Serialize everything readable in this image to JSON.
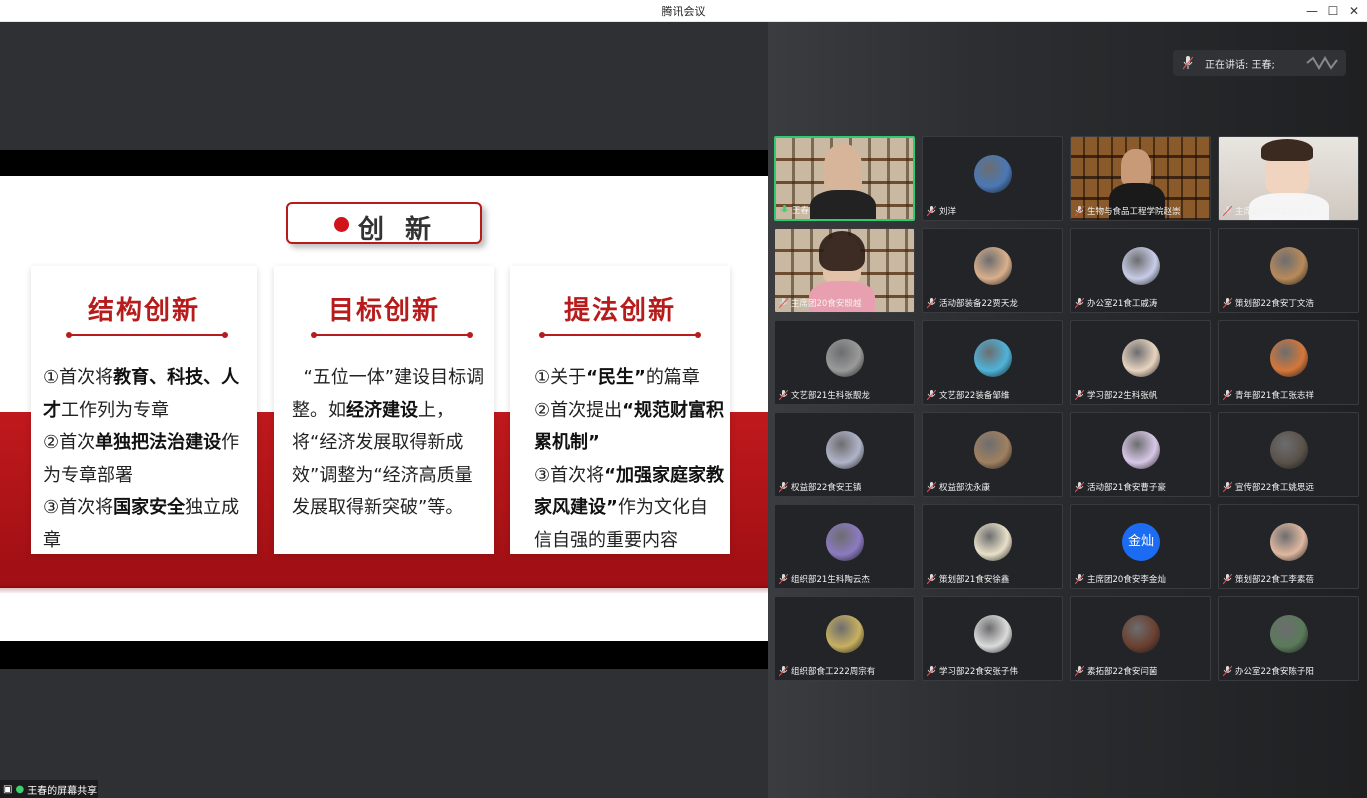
{
  "window": {
    "title": "腾讯会议"
  },
  "slide": {
    "title": "创 新",
    "cards": [
      {
        "heading": "结构创新",
        "html": "①首次将<b>教育、科技、人才</b>工作列为专章<br>②首次<b>单独把法治建设</b>作为专章部署<br>③首次将<b>国家安全</b>独立成章"
      },
      {
        "heading": "目标创新",
        "html": "&nbsp;&nbsp;“五位一体”建设目标调整。如<b>经济建设</b>上，将“经济发展取得新成效”调整为“经济高质量发展取得新突破”等。"
      },
      {
        "heading": "提法创新",
        "html": "①关于<b>“民生”</b>的篇章<br>②首次提出<b>“规范财富积累机制”</b><br>③首次将<b>“加强家庭家教家风建设”</b>作为文化自信自强的重要内容"
      }
    ]
  },
  "speaker": {
    "label": "正在讲话: 王春;"
  },
  "participants": [
    {
      "name": "王春",
      "kind": "video-shelf"
    },
    {
      "name": "刘洋",
      "kind": "avatar",
      "color": "#4a78b5"
    },
    {
      "name": "生物与食品工程学院赵崇",
      "kind": "video-dark"
    },
    {
      "name": "主席团20食工孙兴达",
      "kind": "video-light"
    },
    {
      "name": "主席团20食安殷越",
      "kind": "video-shelf2"
    },
    {
      "name": "活动部装备22贾天龙",
      "kind": "avatar",
      "color": "#d9b08c"
    },
    {
      "name": "办公室21食工戚涛",
      "kind": "avatar",
      "color": "#c8cde8"
    },
    {
      "name": "策划部22食安丁文浩",
      "kind": "avatar",
      "color": "#b98a5a"
    },
    {
      "name": "文艺部21生科张靓龙",
      "kind": "avatar",
      "color": "#9a9a9a"
    },
    {
      "name": "文艺部22装备邹维",
      "kind": "avatar",
      "color": "#4fb3d9"
    },
    {
      "name": "学习部22生科张帆",
      "kind": "avatar",
      "color": "#e8d4c0"
    },
    {
      "name": "青年部21食工张志祥",
      "kind": "avatar",
      "color": "#d4773a"
    },
    {
      "name": "权益部22食安王镇",
      "kind": "avatar",
      "color": "#b0b4c8"
    },
    {
      "name": "权益部沈永康",
      "kind": "avatar",
      "color": "#a08060"
    },
    {
      "name": "活动部21食安曹子豪",
      "kind": "avatar",
      "color": "#d8c8e8"
    },
    {
      "name": "宣传部22食工姚思远",
      "kind": "avatar",
      "color": "#5a524a"
    },
    {
      "name": "组织部21生科陶云杰",
      "kind": "avatar",
      "color": "#8c7ac0"
    },
    {
      "name": "策划部21食安徐鑫",
      "kind": "avatar",
      "color": "#e8e0c8"
    },
    {
      "name": "主席团20食安李金灿",
      "kind": "text-avatar",
      "text": "金灿"
    },
    {
      "name": "策划部22食工李素蓓",
      "kind": "avatar",
      "color": "#e0b8a0"
    },
    {
      "name": "组织部食工222周宗有",
      "kind": "avatar",
      "color": "#c8b060"
    },
    {
      "name": "学习部22食安张子伟",
      "kind": "avatar",
      "color": "#dcdcdc"
    },
    {
      "name": "素拓部22食安闫菌",
      "kind": "avatar",
      "color": "#6a4030"
    },
    {
      "name": "办公室22食安陈子阳",
      "kind": "avatar",
      "color": "#5a7a5a"
    }
  ],
  "sharebar": {
    "label": "王春的屏幕共享"
  }
}
